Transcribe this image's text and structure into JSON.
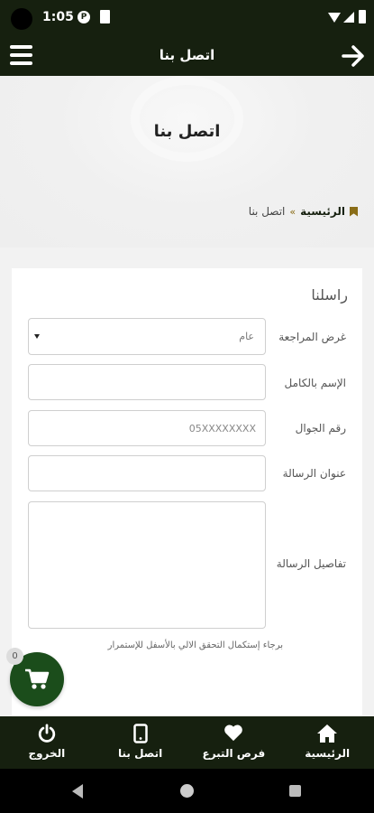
{
  "status_bar": {
    "time": "1:05"
  },
  "app_bar": {
    "title": "اتصل بنا"
  },
  "hero": {
    "title": "اتصل بنا"
  },
  "breadcrumb": {
    "home": "الرئيسية",
    "separator": "»",
    "current": "اتصل بنا"
  },
  "form": {
    "heading": "راسلنا",
    "purpose": {
      "label": "غرض المراجعة",
      "value": "عام"
    },
    "name": {
      "label": "الإسم بالكامل",
      "placeholder": ""
    },
    "mobile": {
      "label": "رقم الجوال",
      "placeholder": "05XXXXXXXX"
    },
    "subject": {
      "label": "عنوان الرسالة",
      "placeholder": ""
    },
    "details": {
      "label": "تفاصيل الرسالة",
      "placeholder": ""
    },
    "captcha_note": "برجاء إستكمال التحقق الالي بالأسفل للإستمرار"
  },
  "cart": {
    "count": "0"
  },
  "bottom_nav": [
    {
      "label": "الرئيسية",
      "icon": "home-icon"
    },
    {
      "label": "فرص التبرع",
      "icon": "heart-icon"
    },
    {
      "label": "اتصل بنا",
      "icon": "mobile-phone-icon"
    },
    {
      "label": "الخروج",
      "icon": "power-icon"
    }
  ],
  "colors": {
    "dark_green": "#16200f",
    "cart_green": "#1b4d1b",
    "gold": "#8a6d18"
  }
}
